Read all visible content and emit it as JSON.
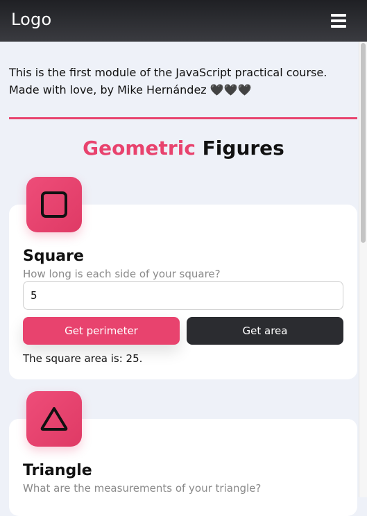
{
  "navbar": {
    "logo": "Logo",
    "menu_icon": "hamburger-menu-icon"
  },
  "intro": {
    "text": "This is the first module of the JavaScript practical course. Made with love, by Mike Hernández 🖤🖤🖤"
  },
  "title": {
    "accent": "Geometric",
    "rest": " Figures"
  },
  "colors": {
    "accent": "#e8436e",
    "dark": "#2b2c30",
    "navbar": "#2a2b30",
    "background": "#eef1f8"
  },
  "square": {
    "icon": "square-icon",
    "title": "Square",
    "subtitle": "How long is each side of your square?",
    "input_value": "5",
    "perimeter_label": "Get perimeter",
    "area_label": "Get area",
    "result": "The square area is: 25."
  },
  "triangle": {
    "icon": "triangle-icon",
    "title": "Triangle",
    "subtitle": "What are the measurements of your triangle?"
  }
}
